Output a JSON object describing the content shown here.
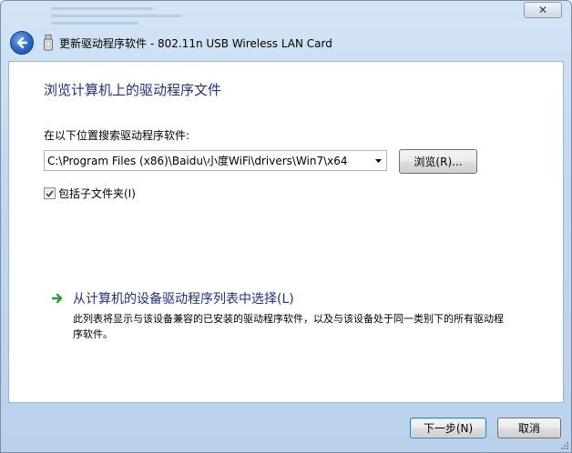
{
  "window": {
    "title": "更新驱动程序软件 - 802.11n USB Wireless LAN Card",
    "close_glyph": "✕"
  },
  "page": {
    "heading": "浏览计算机上的驱动程序文件",
    "search_label": "在以下位置搜索驱动程序软件:",
    "path_value": "C:\\Program Files (x86)\\Baidu\\小度WiFi\\drivers\\Win7\\x64",
    "browse_label": "浏览(R)...",
    "include_subfolders_label": "包括子文件夹(I)",
    "include_subfolders_checked": true,
    "pick_link_title": "从计算机的设备驱动程序列表中选择(L)",
    "pick_link_desc": "此列表将显示与该设备兼容的已安装的驱动程序软件，以及与该设备处于同一类别下的所有驱动程序软件。"
  },
  "footer": {
    "next_label": "下一步(N)",
    "cancel_label": "取消"
  },
  "colors": {
    "heading": "#1e3287",
    "link_arrow": "#2f9a2f",
    "back_button": "#2a66c4"
  },
  "icons": {
    "back": "back-arrow-icon",
    "device": "usb-device-icon",
    "link": "green-arrow-icon",
    "dropdown": "chevron-down-icon",
    "check": "checkmark-icon"
  }
}
